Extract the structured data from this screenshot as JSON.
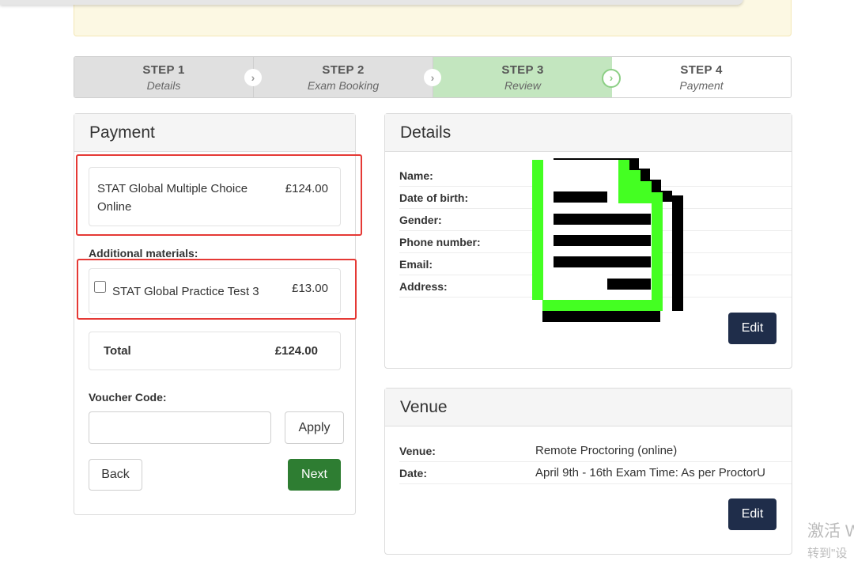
{
  "notice": {
    "text": ""
  },
  "steps": [
    {
      "title": "STEP 1",
      "subtitle": "Details",
      "state": "done"
    },
    {
      "title": "STEP 2",
      "subtitle": "Exam Booking",
      "state": "done"
    },
    {
      "title": "STEP 3",
      "subtitle": "Review",
      "state": "active"
    },
    {
      "title": "STEP 4",
      "subtitle": "Payment",
      "state": "todo"
    }
  ],
  "payment": {
    "title": "Payment",
    "item_name": "STAT Global Multiple Choice Online",
    "item_price": "£124.00",
    "additional_label": "Additional materials:",
    "addon_name": "STAT Global Practice Test 3",
    "addon_price": "£13.00",
    "addon_checked": false,
    "total_label": "Total",
    "total_value": "£124.00",
    "voucher_label": "Voucher Code:",
    "voucher_value": "",
    "apply_label": "Apply",
    "back_label": "Back",
    "next_label": "Next"
  },
  "details": {
    "title": "Details",
    "fields": [
      "Name:",
      "Date of birth:",
      "Gender:",
      "Phone number:",
      "Email:",
      "Address:"
    ],
    "edit_label": "Edit"
  },
  "venue": {
    "title": "Venue",
    "venue_label": "Venue:",
    "venue_value": "Remote Proctoring (online)",
    "date_label": "Date:",
    "date_value": "April 9th - 16th Exam Time: As per ProctorU",
    "edit_label": "Edit"
  },
  "watermark": {
    "line1": "激活 W",
    "line2": "转到\"设"
  },
  "colors": {
    "active_step": "#c3e6bf",
    "next_button": "#2e7d32",
    "edit_button": "#1f2d4a",
    "highlight": "#e53935",
    "doc_icon_green": "#44ff22"
  }
}
